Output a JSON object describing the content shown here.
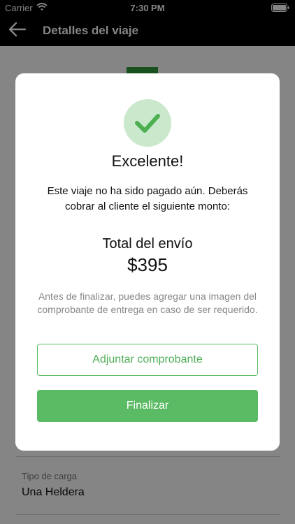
{
  "status_bar": {
    "carrier": "Carrier",
    "time": "7:30 PM",
    "icons": [
      "wifi-icon",
      "battery-icon"
    ]
  },
  "nav": {
    "title": "Detalles del viaje",
    "back_icon": "arrow-left-icon"
  },
  "background": {
    "field_label": "Tipo de carga",
    "field_value": "Una Heldera"
  },
  "modal": {
    "icon": "checkmark-icon",
    "title": "Excelente!",
    "message": "Este viaje no ha sido pagado aún. Deberás cobrar al cliente el siguiente monto:",
    "total_label": "Total del envío",
    "total_amount": "$395",
    "hint": "Antes de finalizar, puedes agregar una imagen del comprobante de entrega en caso de ser requerido.",
    "attach_button": "Adjuntar comprobante",
    "finish_button": "Finalizar"
  },
  "colors": {
    "accent": "#5bbb64",
    "check_bg": "#c9e8cc",
    "overlay": "rgba(0,0,0,0.48)"
  }
}
